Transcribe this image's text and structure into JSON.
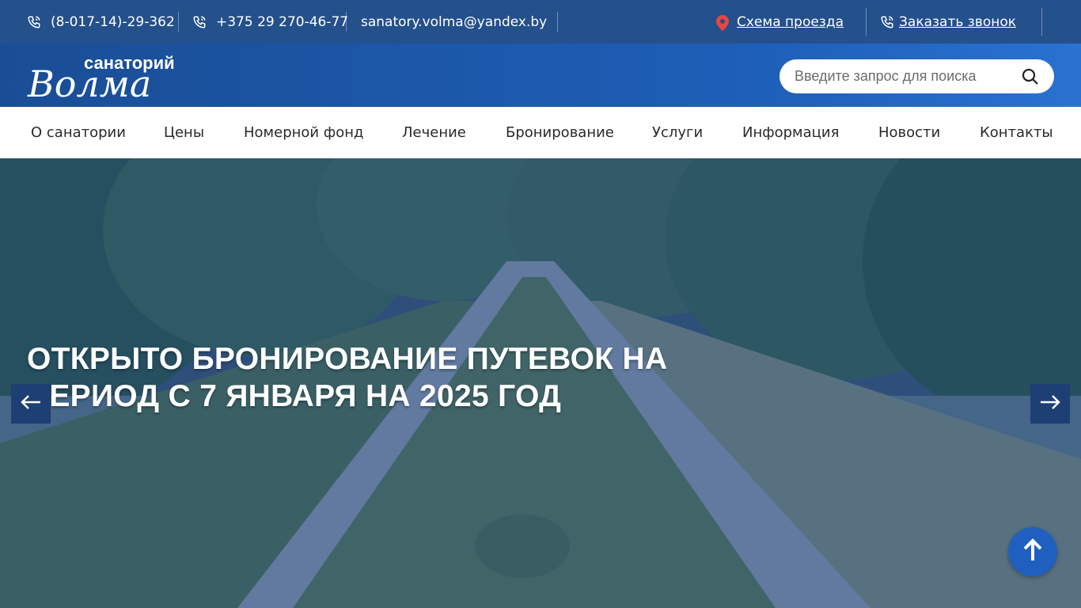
{
  "topbar": {
    "phone1": "(8-017-14)-29-362",
    "phone2": "+375 29 270-46-77",
    "email": "sanatory.volma@yandex.by",
    "route_link": "Схема проезда",
    "callback_link": "Заказать звонок"
  },
  "logo": {
    "top_text": "санаторий",
    "brand_text": "Волма"
  },
  "search": {
    "placeholder": "Введите запрос для поиска"
  },
  "nav": {
    "items": [
      "О санатории",
      "Цены",
      "Номерной фонд",
      "Лечение",
      "Бронирование",
      "Услуги",
      "Информация",
      "Новости",
      "Контакты"
    ]
  },
  "hero": {
    "title": "Открыто бронирование путевок на период с 7 января на 2025 год"
  },
  "icons": {
    "phone": "phone-icon",
    "location": "location-pin-icon",
    "search": "search-icon",
    "prev": "arrow-left-icon",
    "next": "arrow-right-icon",
    "top": "arrow-up-icon"
  },
  "colors": {
    "topbar_bg": "#24508c",
    "header_bg": "#1e5fb8",
    "pin": "#e8463f",
    "to_top": "#1f5fbf"
  }
}
